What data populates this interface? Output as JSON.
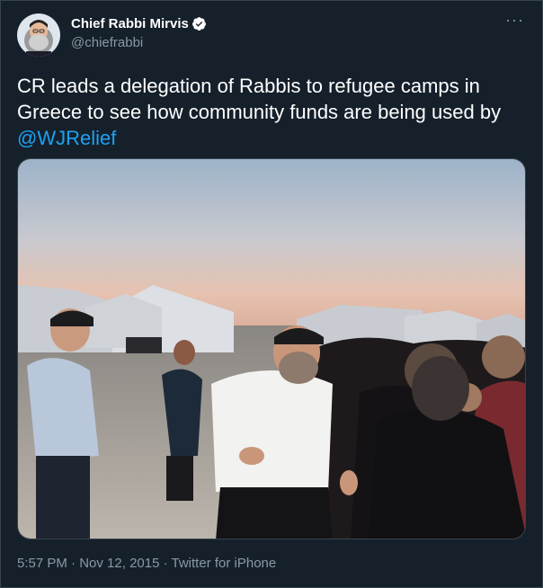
{
  "author": {
    "display_name": "Chief Rabbi Mirvis",
    "handle": "@chiefrabbi",
    "verified": true,
    "avatar_icon": "profile-avatar"
  },
  "more_label": "···",
  "tweet": {
    "text_before": "CR leads a delegation of Rabbis to refugee camps in Greece to see how community funds are being used by ",
    "mention": "@WJRelief"
  },
  "photo": {
    "icon": "photo-refugee-camp"
  },
  "meta": {
    "time": "5:57 PM",
    "separator1": " · ",
    "date": "Nov 12, 2015",
    "separator2": " · ",
    "source": "Twitter for iPhone"
  },
  "colors": {
    "background": "#15202b",
    "accent": "#1da1f2",
    "secondary_text": "#8899a6",
    "border": "#38444d"
  }
}
